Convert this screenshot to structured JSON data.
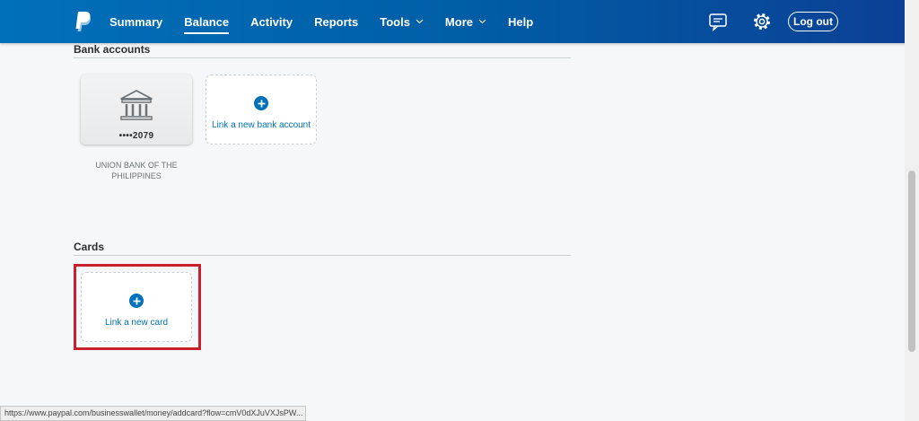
{
  "header": {
    "nav": [
      "Summary",
      "Balance",
      "Activity",
      "Reports",
      "Tools",
      "More",
      "Help"
    ],
    "active_tab": "Balance",
    "logout_label": "Log out",
    "icons": {
      "logo": "paypal-logo-icon",
      "messages": "message-center-icon",
      "settings": "gear-icon"
    },
    "colors": {
      "bar_start": "#0070ba",
      "bar_end": "#0c3f95"
    }
  },
  "bank_section": {
    "title": "Bank accounts",
    "account": {
      "mask": "••••2079",
      "name": "UNION BANK OF THE PHILIPPINES",
      "icon": "bank-icon"
    },
    "link_label": "Link a new bank account"
  },
  "cards_section": {
    "title": "Cards",
    "link_label": "Link a new card",
    "highlight_color": "#c8202d"
  },
  "status_bar": {
    "url": "https://www.paypal.com/businesswallet/money/addcard?flow=cmV0dXJuVXJsPW..."
  },
  "accent_color": "#0070ba"
}
